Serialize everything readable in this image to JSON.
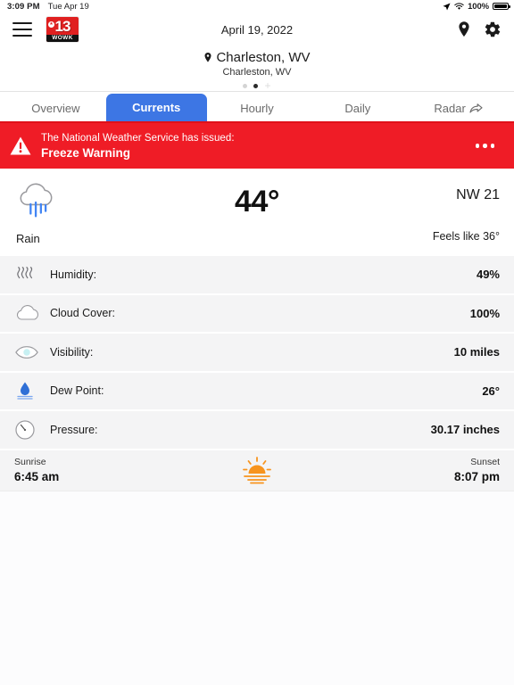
{
  "status_bar": {
    "time": "3:09 PM",
    "date": "Tue Apr 19",
    "battery_percent": "100%",
    "icons": [
      "location-arrow-icon",
      "wifi-icon",
      "battery-icon"
    ]
  },
  "navbar": {
    "menu_icon": "hamburger-menu-icon",
    "logo": {
      "channel": "13",
      "callsign": "WOWK"
    },
    "date": "April 19, 2022",
    "location_icon": "location-pin-icon",
    "settings_icon": "gear-icon"
  },
  "location": {
    "pin_icon": "location-pin-icon",
    "primary": "Charleston, WV",
    "secondary": "Charleston, WV",
    "pager": {
      "count": 2,
      "active_index": 1,
      "add_label": "+"
    }
  },
  "tabs": [
    {
      "label": "Overview",
      "active": false,
      "icon": null
    },
    {
      "label": "Currents",
      "active": true,
      "icon": null
    },
    {
      "label": "Hourly",
      "active": false,
      "icon": null
    },
    {
      "label": "Daily",
      "active": false,
      "icon": null
    },
    {
      "label": "Radar",
      "active": false,
      "icon": "external-link-arrow-icon"
    }
  ],
  "alert": {
    "icon": "warning-triangle-icon",
    "line1": "The National Weather Service has issued:",
    "line2": "Freeze Warning",
    "more_icon": "overflow-menu-icon",
    "color": "#ef1c26"
  },
  "current": {
    "condition_icon": "rain-cloud-icon",
    "condition": "Rain",
    "temperature": "44°",
    "wind": "NW 21",
    "feels_like": "Feels like 36°"
  },
  "details": [
    {
      "icon": "humidity-waves-icon",
      "label": "Humidity:",
      "value": "49%"
    },
    {
      "icon": "cloud-icon",
      "label": "Cloud Cover:",
      "value": "100%"
    },
    {
      "icon": "eye-visibility-icon",
      "label": "Visibility:",
      "value": "10 miles"
    },
    {
      "icon": "water-droplet-icon",
      "label": "Dew Point:",
      "value": "26°"
    },
    {
      "icon": "pressure-gauge-icon",
      "label": "Pressure:",
      "value": "30.17 inches"
    }
  ],
  "sun": {
    "sunrise_label": "Sunrise",
    "sunrise_time": "6:45 am",
    "sunset_label": "Sunset",
    "sunset_time": "8:07 pm",
    "icon": "sunrise-icon"
  },
  "colors": {
    "accent_blue": "#3d76e4",
    "alert_red": "#ef1c26",
    "logo_red": "#e02020",
    "sun_orange": "#f7941e",
    "row_bg": "#f4f4f5"
  }
}
